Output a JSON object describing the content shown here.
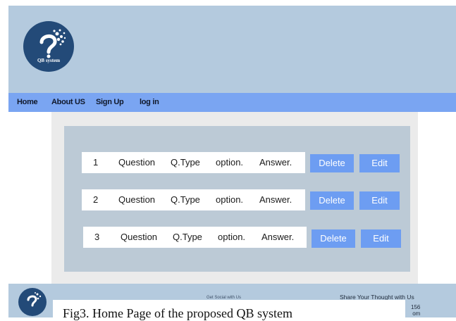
{
  "brand": {
    "logo_text": "QB system"
  },
  "nav": {
    "items": [
      {
        "label": "Home"
      },
      {
        "label": "About US"
      },
      {
        "label": "Sign Up"
      },
      {
        "label": "log in"
      }
    ]
  },
  "questions": {
    "rows": [
      {
        "num": "1",
        "question": "Question",
        "qtype": "Q.Type",
        "option": "option.",
        "answer": "Answer.",
        "delete_label": "Delete",
        "edit_label": "Edit"
      },
      {
        "num": "2",
        "question": "Question",
        "qtype": "Q.Type",
        "option": "option.",
        "answer": "Answer.",
        "delete_label": "Delete",
        "edit_label": "Edit"
      },
      {
        "num": "3",
        "question": "Question",
        "qtype": "Q.Type",
        "option": "option.",
        "answer": "Answer.",
        "delete_label": "Delete",
        "edit_label": "Edit"
      }
    ]
  },
  "footer": {
    "social_text": "Get Social with Us",
    "share_text": "Share Your Thought with Us",
    "partial_line1": "156",
    "partial_line2": "om"
  },
  "caption": "Fig3. Home Page of the proposed QB system",
  "colors": {
    "header_bg": "#b4cade",
    "nav_bg": "#7aa5f2",
    "panel_bg": "#bccad6",
    "button_bg": "#6d9df2",
    "logo_bg": "#234a78"
  }
}
